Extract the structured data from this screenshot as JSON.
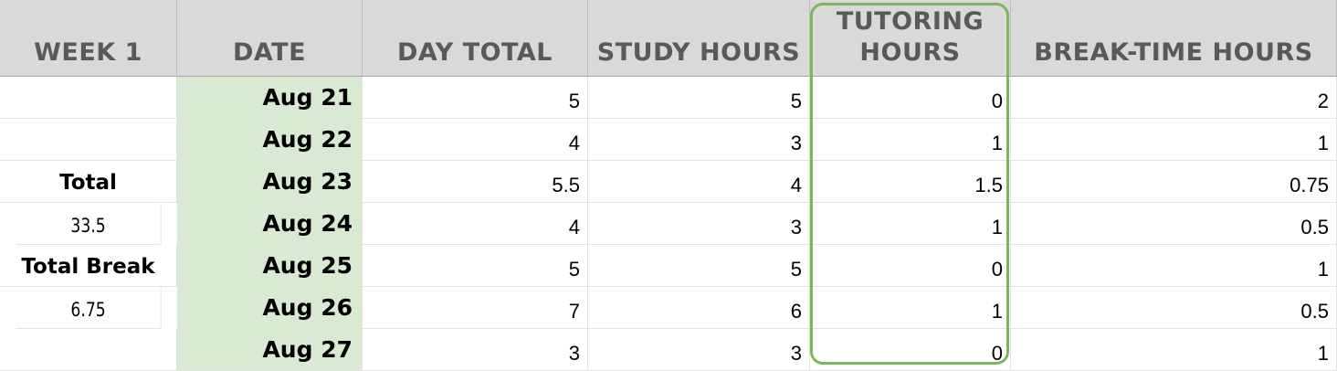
{
  "headers": {
    "week": "WEEK 1",
    "date": "DATE",
    "day_total": "DAY TOTAL",
    "study_hours": "STUDY HOURS",
    "tutoring_line1": "TUTORING",
    "tutoring_line2": "HOURS",
    "break_time": "BREAK-TIME HOURS"
  },
  "summary": {
    "total_label": "Total",
    "total_value": "33.5",
    "break_label": "Total Break",
    "break_value": "6.75"
  },
  "rows": [
    {
      "date": "Aug 21",
      "day_total": "5",
      "study": "5",
      "tutoring": "0",
      "break": "2"
    },
    {
      "date": "Aug 22",
      "day_total": "4",
      "study": "3",
      "tutoring": "1",
      "break": "1"
    },
    {
      "date": "Aug 23",
      "day_total": "5.5",
      "study": "4",
      "tutoring": "1.5",
      "break": "0.75"
    },
    {
      "date": "Aug 24",
      "day_total": "4",
      "study": "3",
      "tutoring": "1",
      "break": "0.5"
    },
    {
      "date": "Aug 25",
      "day_total": "5",
      "study": "5",
      "tutoring": "0",
      "break": "1"
    },
    {
      "date": "Aug 26",
      "day_total": "7",
      "study": "6",
      "tutoring": "1",
      "break": "0.5"
    },
    {
      "date": "Aug 27",
      "day_total": "3",
      "study": "3",
      "tutoring": "0",
      "break": "1"
    }
  ],
  "colors": {
    "header_bg": "#d9d9d9",
    "date_bg": "#d9ead3",
    "highlight_border": "#7db65a"
  }
}
